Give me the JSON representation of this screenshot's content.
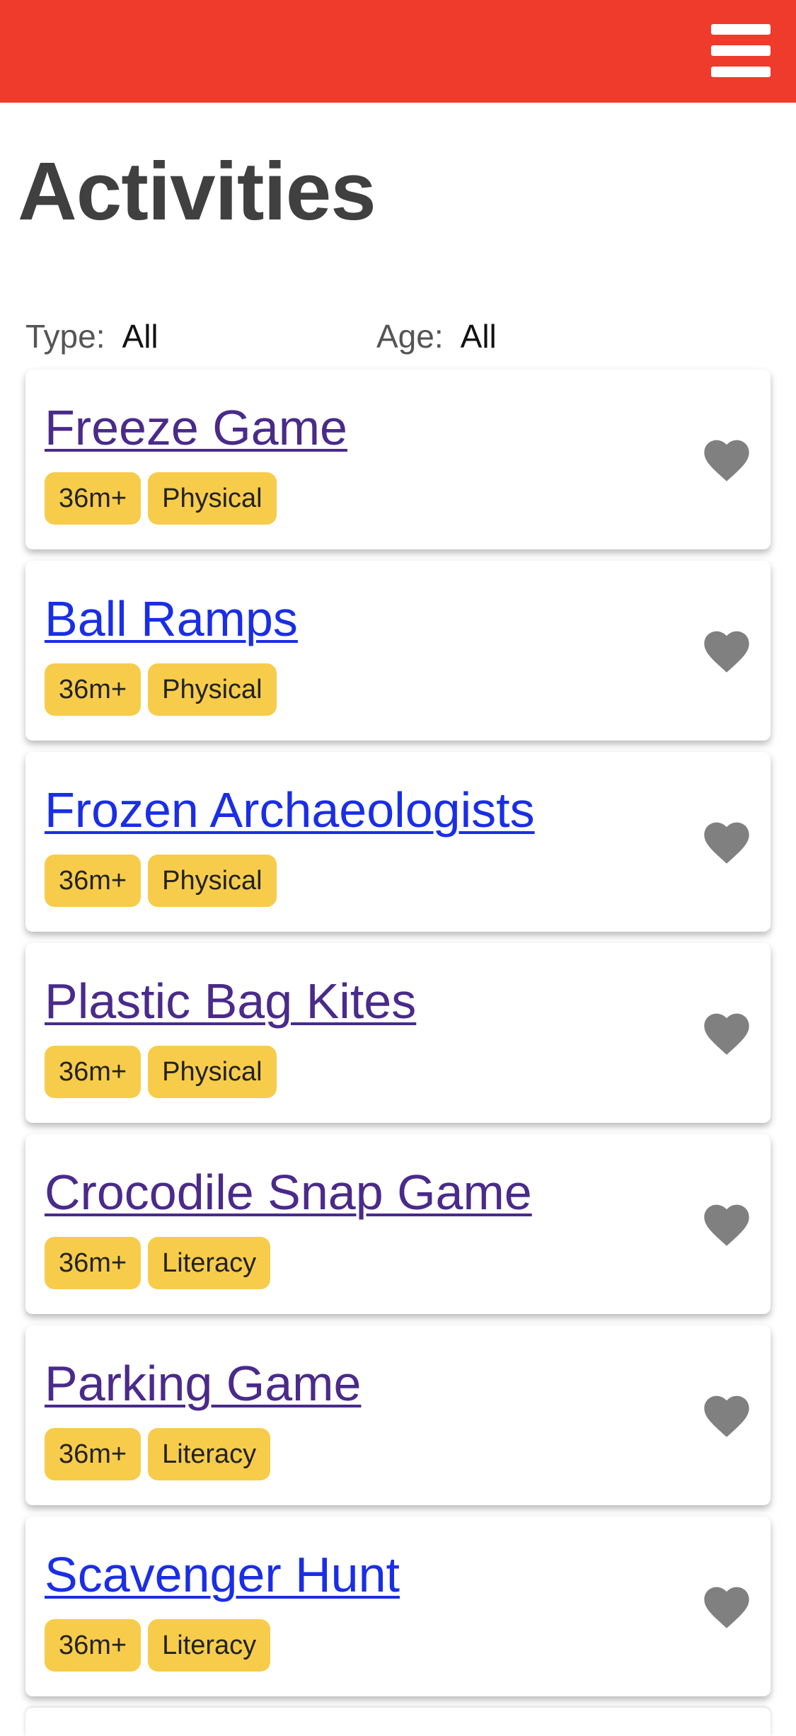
{
  "header": {
    "color": "#ee3b2b",
    "menu_icon": "hamburger-menu-icon"
  },
  "page": {
    "title": "Activities"
  },
  "filters": {
    "type": {
      "label": "Type:",
      "value": "All"
    },
    "age": {
      "label": "Age:",
      "value": "All"
    }
  },
  "activities": [
    {
      "title": "Freeze Game",
      "tags": [
        "36m+",
        "Physical"
      ],
      "visited": true,
      "favorite_icon": "heart-icon"
    },
    {
      "title": "Ball Ramps",
      "tags": [
        "36m+",
        "Physical"
      ],
      "visited": false,
      "favorite_icon": "heart-icon"
    },
    {
      "title": "Frozen Archaeologists",
      "tags": [
        "36m+",
        "Physical"
      ],
      "visited": false,
      "favorite_icon": "heart-icon"
    },
    {
      "title": "Plastic Bag Kites",
      "tags": [
        "36m+",
        "Physical"
      ],
      "visited": true,
      "favorite_icon": "heart-icon"
    },
    {
      "title": "Crocodile Snap Game",
      "tags": [
        "36m+",
        "Literacy"
      ],
      "visited": true,
      "favorite_icon": "heart-icon"
    },
    {
      "title": "Parking Game",
      "tags": [
        "36m+",
        "Literacy"
      ],
      "visited": true,
      "favorite_icon": "heart-icon"
    },
    {
      "title": "Scavenger Hunt",
      "tags": [
        "36m+",
        "Literacy"
      ],
      "visited": false,
      "favorite_icon": "heart-icon"
    }
  ],
  "colors": {
    "tag_background": "#f7cc4a",
    "link": "#1a2ee6",
    "visited_link": "#4a2a8a",
    "heart": "#808080"
  }
}
